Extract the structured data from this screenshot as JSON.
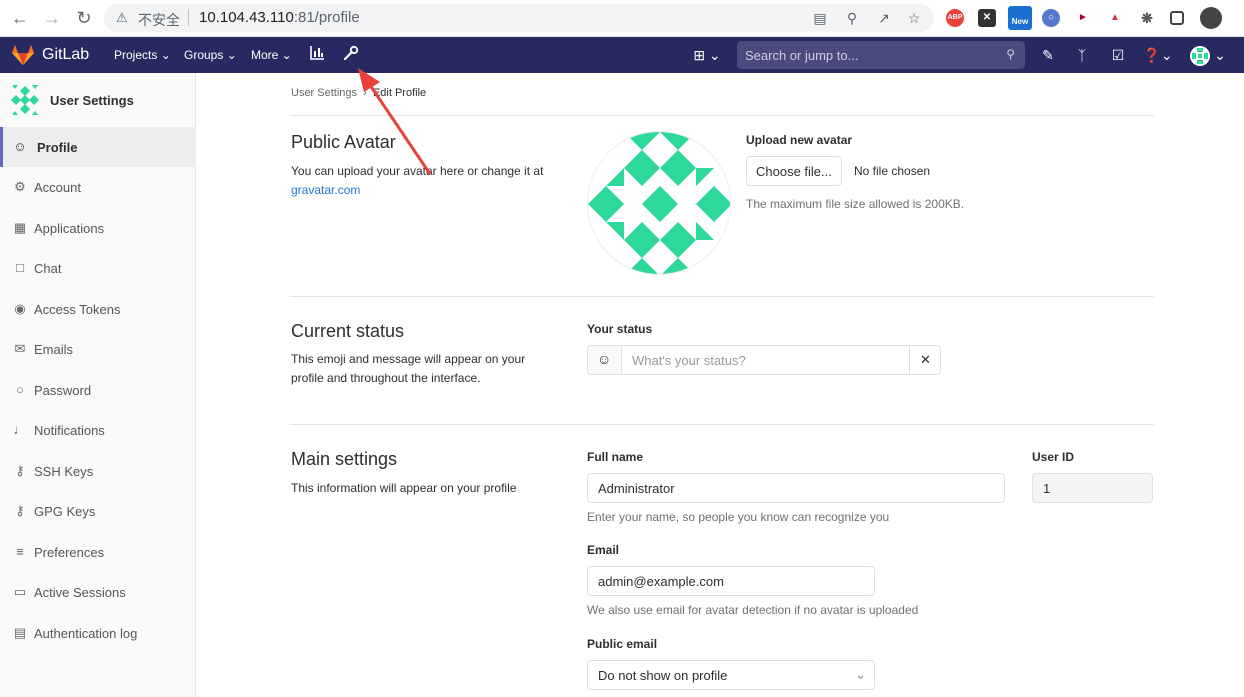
{
  "browser": {
    "insecure_label": "不安全",
    "url_host": "10.104.43.110",
    "url_path": ":81/profile"
  },
  "extensions": {
    "abp": "ABP",
    "new_badge": "New"
  },
  "topnav": {
    "brand": "GitLab",
    "projects": "Projects",
    "groups": "Groups",
    "more": "More",
    "search_placeholder": "Search or jump to..."
  },
  "sidebar": {
    "title": "User Settings",
    "items": [
      {
        "label": "Profile",
        "icon": "profile-icon"
      },
      {
        "label": "Account",
        "icon": "account-icon"
      },
      {
        "label": "Applications",
        "icon": "applications-icon"
      },
      {
        "label": "Chat",
        "icon": "chat-icon"
      },
      {
        "label": "Access Tokens",
        "icon": "token-icon"
      },
      {
        "label": "Emails",
        "icon": "mail-icon"
      },
      {
        "label": "Password",
        "icon": "lock-icon"
      },
      {
        "label": "Notifications",
        "icon": "bell-icon"
      },
      {
        "label": "SSH Keys",
        "icon": "key-icon"
      },
      {
        "label": "GPG Keys",
        "icon": "key-icon"
      },
      {
        "label": "Preferences",
        "icon": "preferences-icon"
      },
      {
        "label": "Active Sessions",
        "icon": "monitor-icon"
      },
      {
        "label": "Authentication log",
        "icon": "log-icon"
      }
    ]
  },
  "breadcrumb": {
    "parent": "User Settings",
    "current": "Edit Profile"
  },
  "avatar_section": {
    "title": "Public Avatar",
    "desc": "You can upload your avatar here or change it at",
    "link": "gravatar.com",
    "upload_label": "Upload new avatar",
    "choose_button": "Choose file...",
    "no_file": "No file chosen",
    "max_size": "The maximum file size allowed is 200KB."
  },
  "status_section": {
    "title": "Current status",
    "desc": "This emoji and message will appear on your profile and throughout the interface.",
    "label": "Your status",
    "placeholder": "What's your status?"
  },
  "main_section": {
    "title": "Main settings",
    "desc": "This information will appear on your profile",
    "full_name_label": "Full name",
    "full_name_value": "Administrator",
    "full_name_help": "Enter your name, so people you know can recognize you",
    "user_id_label": "User ID",
    "user_id_value": "1",
    "email_label": "Email",
    "email_value": "admin@example.com",
    "email_help": "We also use email for avatar detection if no avatar is uploaded",
    "public_email_label": "Public email",
    "public_email_value": "Do not show on profile"
  },
  "colors": {
    "nav": "#292961",
    "avatar_green": "#2dd89a",
    "accent": "#6666c4",
    "annotation_arrow": "#e8413a"
  }
}
